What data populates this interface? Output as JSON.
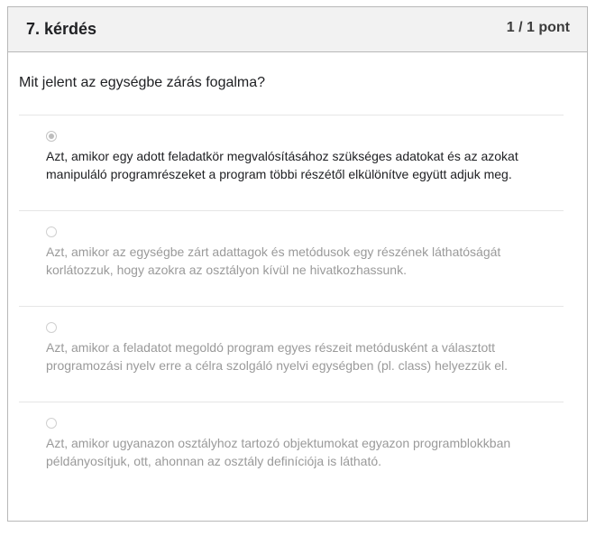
{
  "header": {
    "question_number": "7. kérdés",
    "score": "1 / 1 pont"
  },
  "question": {
    "text": "Mit jelent az egységbe zárás fogalma?"
  },
  "options": [
    {
      "text": "Azt, amikor egy adott feladatkör megvalósításához szükséges adatokat és az azokat manipuláló programrészeket a program többi részétől elkülönítve együtt adjuk meg.",
      "selected": true
    },
    {
      "text": "Azt, amikor az egységbe zárt adattagok és metódusok egy részének láthatóságát korlátozzuk, hogy azokra az osztályon kívül ne hivatkozhassunk.",
      "selected": false
    },
    {
      "text": "Azt, amikor a feladatot megoldó program egyes részeit metódusként a választott programozási nyelv erre a célra szolgáló nyelvi egységben (pl. class) helyezzük el.",
      "selected": false
    },
    {
      "text": "Azt, amikor ugyanazon osztályhoz tartozó objektumokat egyazon programblokkban példányosítjuk, ott, ahonnan az osztály definíciója is látható.",
      "selected": false
    }
  ]
}
